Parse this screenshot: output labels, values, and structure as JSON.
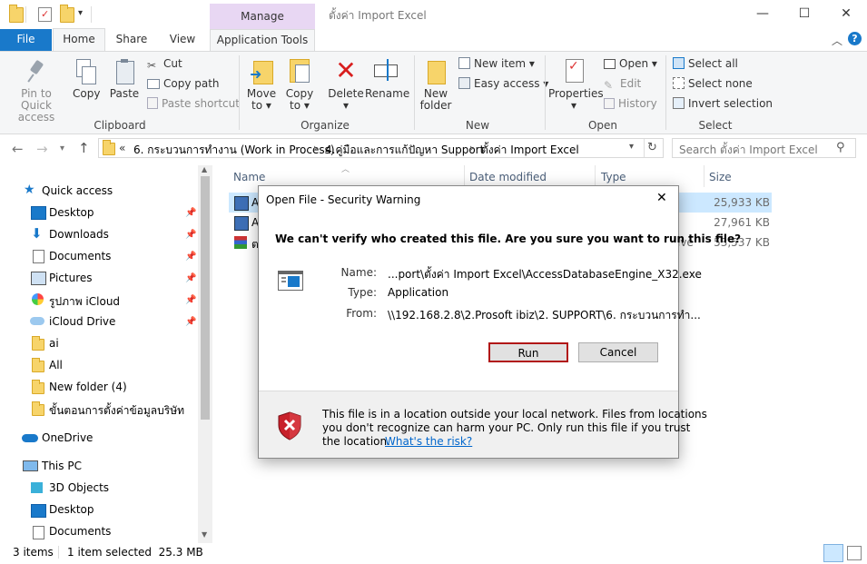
{
  "window": {
    "title": "ตั้งค่า Import Excel",
    "manage_label": "Manage",
    "minimize": "—",
    "maximize": "☐",
    "close": "✕"
  },
  "tabs": {
    "file": "File",
    "home": "Home",
    "share": "Share",
    "view": "View",
    "app_tools": "Application Tools"
  },
  "ribbon": {
    "clipboard": {
      "label": "Clipboard",
      "pin": "Pin to Quick access",
      "copy": "Copy",
      "paste": "Paste",
      "cut": "Cut",
      "copy_path": "Copy path",
      "paste_shortcut": "Paste shortcut"
    },
    "organize": {
      "label": "Organize",
      "move_to": "Move to",
      "copy_to": "Copy to",
      "delete": "Delete",
      "rename": "Rename"
    },
    "new": {
      "label": "New",
      "new_folder": "New folder",
      "new_item": "New item",
      "easy_access": "Easy access"
    },
    "open": {
      "label": "Open",
      "properties": "Properties",
      "open": "Open",
      "edit": "Edit",
      "history": "History"
    },
    "select": {
      "label": "Select",
      "select_all": "Select all",
      "select_none": "Select none",
      "invert": "Invert selection"
    }
  },
  "address": {
    "overflow": "«",
    "crumbs": [
      "6. กระบวนการทำงาน (Work in Process)",
      "4.คู่มือและการแก้ปัญหา Support",
      "ตั้งค่า Import Excel"
    ],
    "separator": "›",
    "search_placeholder": "Search ตั้งค่า Import Excel"
  },
  "nav": {
    "quick_access": "Quick access",
    "items": [
      "Desktop",
      "Downloads",
      "Documents",
      "Pictures",
      "รูปภาพ iCloud",
      "iCloud Drive",
      "ai",
      "All",
      "New folder (4)",
      "ขั้นตอนการตั้งค่าข้อมูลบริษัท"
    ],
    "onedrive": "OneDrive",
    "this_pc": "This PC",
    "pc_items": [
      "3D Objects",
      "Desktop",
      "Documents"
    ]
  },
  "files": {
    "columns": {
      "name": "Name",
      "date": "Date modified",
      "type": "Type",
      "size": "Size"
    },
    "rows": [
      {
        "name": "A",
        "type": "",
        "size": "25,933 KB"
      },
      {
        "name": "A",
        "type": "",
        "size": "27,961 KB"
      },
      {
        "name": "ต",
        "type": "ive",
        "size": "53,537 KB"
      }
    ]
  },
  "status": {
    "items": "3 items",
    "selected": "1 item selected  25.3 MB"
  },
  "dialog": {
    "title": "Open File - Security Warning",
    "close": "✕",
    "question": "We can't verify who created this file. Are you sure you want to run this file?",
    "name_label": "Name:",
    "name_value": "...port\\ตั้งค่า Import Excel\\AccessDatabaseEngine_X32.exe",
    "type_label": "Type:",
    "type_value": "Application",
    "from_label": "From:",
    "from_value": "\\\\192.168.2.8\\2.Prosoft ibiz\\2. SUPPORT\\6. กระบวนการทำ...",
    "run": "Run",
    "cancel": "Cancel",
    "warning_text_1": "This file is in a location outside your local network. Files from locations",
    "warning_text_2": "you don't recognize can harm your PC. Only run this file if you trust",
    "warning_text_3": "the location.",
    "risk_link": "What's the risk?"
  },
  "colors": {
    "accent": "#1979ca",
    "manage_tab": "#e8d7f3",
    "run_border": "#b11717",
    "link": "#0066cc"
  }
}
